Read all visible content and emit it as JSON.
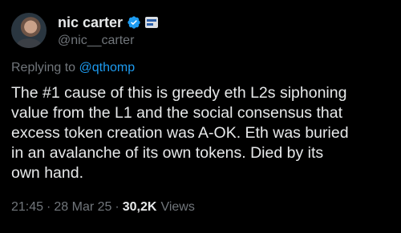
{
  "author": {
    "display_name": "nic carter",
    "handle": "@nic__carter",
    "avatar_icon": "profile-photo",
    "verified_icon": "verified-badge-icon",
    "affiliate_icon": "affiliate-badge-icon"
  },
  "reply": {
    "prefix": "Replying to ",
    "mention": "@qthomp"
  },
  "tweet": {
    "text": "The #1 cause of this is greedy eth L2s siphoning\nvalue from the L1 and the social consensus that\nexcess token creation was A-OK. Eth was buried\nin an avalanche of its own tokens. Died by its\nown hand."
  },
  "meta": {
    "time": "21:45",
    "separator": "·",
    "date": "28 Mar 25",
    "views_count": "30,2K",
    "views_label": "Views"
  },
  "colors": {
    "background": "#000000",
    "text": "#e7e9ea",
    "secondary": "#71767b",
    "accent": "#1d9bf0"
  }
}
